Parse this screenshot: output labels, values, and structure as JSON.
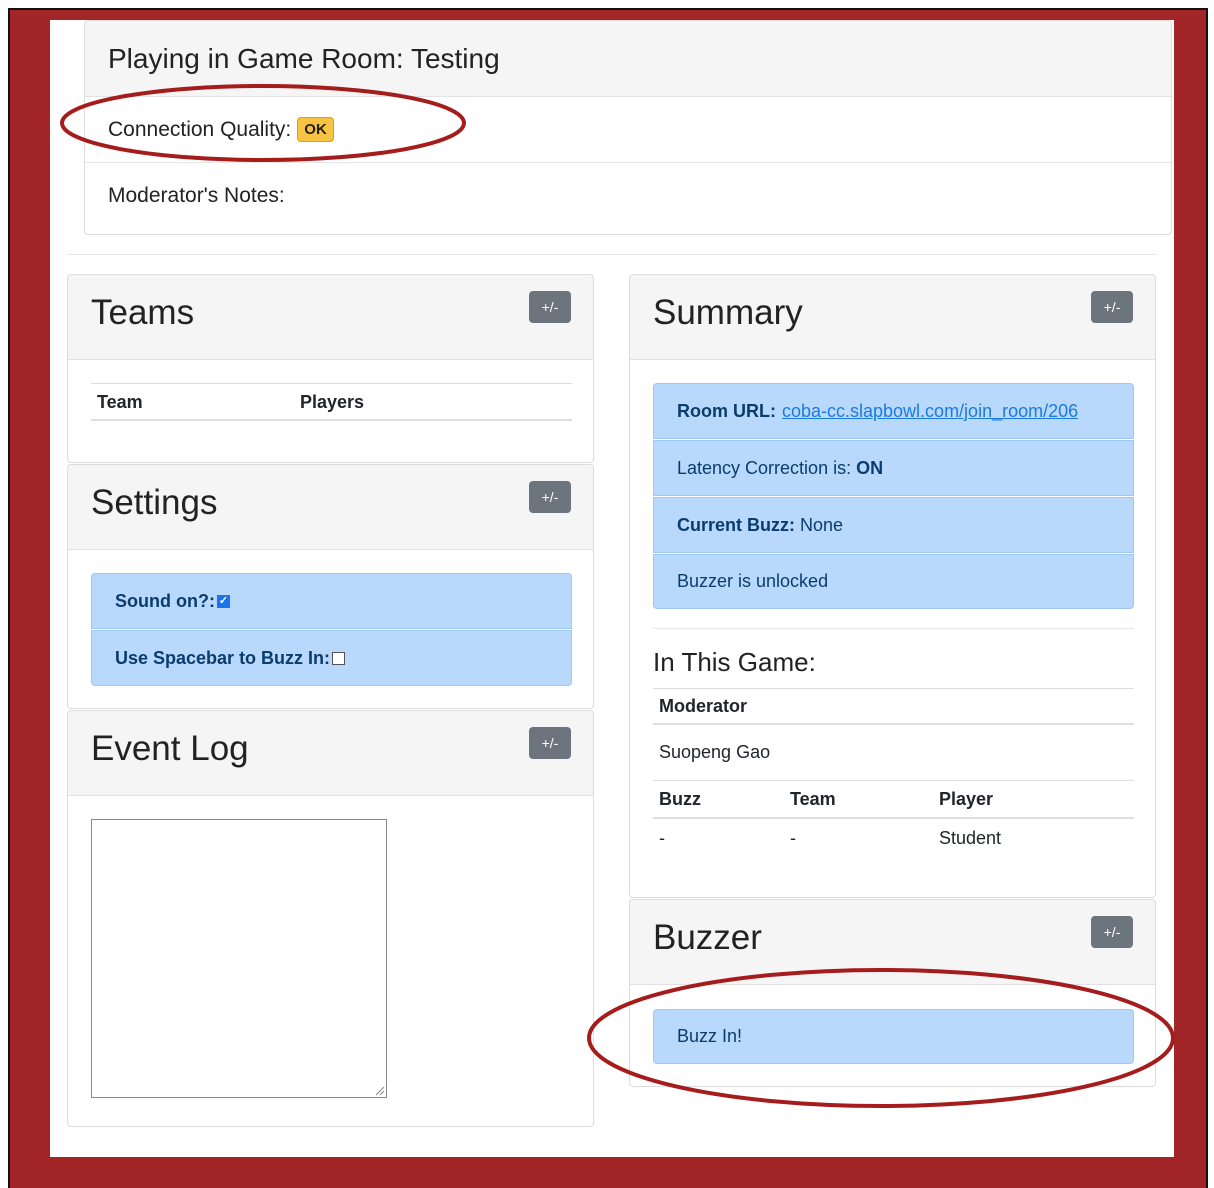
{
  "room": {
    "title": "Playing in Game Room: Testing",
    "connection_label": "Connection Quality:",
    "connection_status": "OK",
    "notes_label": "Moderator's Notes:"
  },
  "teams_panel": {
    "title": "Teams",
    "toggle_label": "+/-",
    "columns": [
      "Team",
      "Players"
    ]
  },
  "settings_panel": {
    "title": "Settings",
    "toggle_label": "+/-",
    "sound_label": "Sound on?:",
    "sound_checked": true,
    "spacebar_label": "Use Spacebar to Buzz In:",
    "spacebar_checked": false
  },
  "event_log_panel": {
    "title": "Event Log",
    "toggle_label": "+/-",
    "log_text": ""
  },
  "summary_panel": {
    "title": "Summary",
    "toggle_label": "+/-",
    "room_url_label": "Room URL:",
    "room_url": "coba-cc.slapbowl.com/join_room/206",
    "latency_label": "Latency Correction is:",
    "latency_value": "ON",
    "current_buzz_label": "Current Buzz:",
    "current_buzz_value": "None",
    "buzzer_status": "Buzzer is unlocked",
    "in_this_game_heading": "In This Game:",
    "moderator_header": "Moderator",
    "moderator_name": "Suopeng Gao",
    "buzz_columns": [
      "Buzz",
      "Team",
      "Player"
    ],
    "buzz_rows": [
      [
        "-",
        "-",
        "Student"
      ]
    ]
  },
  "buzzer_panel": {
    "title": "Buzzer",
    "toggle_label": "+/-",
    "buzz_button_label": "Buzz In!"
  },
  "colors": {
    "frame": "#a22528",
    "info_blue": "#b8d9fb",
    "badge_warning": "#f6c343",
    "annotation": "#a51c1c"
  }
}
